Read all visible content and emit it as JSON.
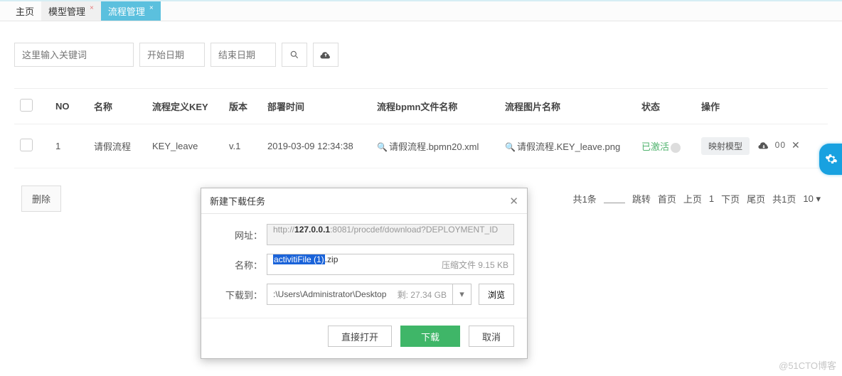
{
  "tabs": [
    {
      "label": "主页"
    },
    {
      "label": "模型管理",
      "close": "×"
    },
    {
      "label": "流程管理",
      "close": "×"
    }
  ],
  "filters": {
    "keyword_placeholder": "这里输入关键词",
    "start_date_placeholder": "开始日期",
    "end_date_placeholder": "结束日期"
  },
  "table": {
    "headers": {
      "no": "NO",
      "name": "名称",
      "key": "流程定义KEY",
      "version": "版本",
      "deploy_time": "部署时间",
      "bpmn": "流程bpmn文件名称",
      "image": "流程图片名称",
      "status": "状态",
      "ops": "操作"
    },
    "rows": [
      {
        "no": "1",
        "name": "请假流程",
        "key": "KEY_leave",
        "version": "v.1",
        "deploy_time": "2019-03-09 12:34:38",
        "bpmn": "请假流程.bpmn20.xml",
        "image": "请假流程.KEY_leave.png",
        "status": "已激活",
        "op_label": "映射模型"
      }
    ]
  },
  "actions": {
    "delete": "删除"
  },
  "pager": {
    "total_prefix": "共",
    "total": "1",
    "total_suffix": "条",
    "jump": "跳转",
    "first": "首页",
    "prev": "上页",
    "current": "1",
    "next": "下页",
    "last": "尾页",
    "pages_prefix": "共",
    "pages": "1",
    "pages_suffix": "页",
    "page_size": "10"
  },
  "dialog": {
    "title": "新建下载任务",
    "url_label": "网址：",
    "url_prefix": "http://",
    "url_host": "127.0.0.1",
    "url_rest": ":8081/procdef/download?DEPLOYMENT_ID",
    "name_label": "名称：",
    "file_name_sel": "activitiFile (1)",
    "file_ext": ".zip",
    "file_type": "压缩文件",
    "file_size": "9.15 KB",
    "saveto_label": "下载到：",
    "save_path": ":\\Users\\Administrator\\Desktop",
    "remain_label": "剩:",
    "remain_size": "27.34 GB",
    "browse": "浏览",
    "open_direct": "直接打开",
    "download": "下载",
    "cancel": "取消"
  },
  "watermark": "@51CTO博客"
}
